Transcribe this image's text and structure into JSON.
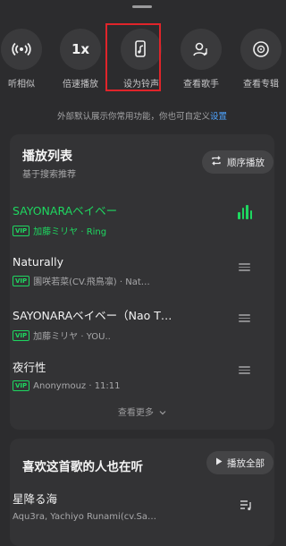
{
  "actions": [
    {
      "label": "听相似",
      "glyph": "((·))"
    },
    {
      "label": "倍速播放",
      "glyph": "1x"
    },
    {
      "label": "设为铃声",
      "glyph": "ringtone"
    },
    {
      "label": "查看歌手",
      "glyph": "artist"
    },
    {
      "label": "查看专辑",
      "glyph": "album"
    }
  ],
  "hint": {
    "text": "外部默认展示你常用功能，你也可自定义",
    "link": "设置"
  },
  "playlist": {
    "title": "播放列表",
    "subtitle": "基于搜索推荐",
    "order_label": "顺序播放",
    "songs": [
      {
        "title": "SAYONARAベイベー",
        "badge": "VIP",
        "meta": "加藤ミリヤ · Ring",
        "active": true
      },
      {
        "title": "Naturally",
        "badge": "VIP",
        "meta": "園咲若菜(CV.飛鳥凛) · Nat…",
        "active": false
      },
      {
        "title": "SAYONARAベイベー（Nao T…",
        "badge": "VIP",
        "meta": "加藤ミリヤ · YOU..",
        "active": false
      },
      {
        "title": "夜行性",
        "badge": "VIP",
        "meta": "Anonymouz · 11:11",
        "active": false
      }
    ],
    "more_label": "查看更多"
  },
  "also": {
    "title": "喜欢这首歌的人也在听",
    "play_all_label": "播放全部",
    "song": {
      "title": "星降る海",
      "meta": "Aqu3ra, Yachiyo Runami(cv.Sa…"
    }
  },
  "colors": {
    "accent": "#1ed760",
    "highlight": "#e0242a",
    "link": "#4ea4ff"
  }
}
